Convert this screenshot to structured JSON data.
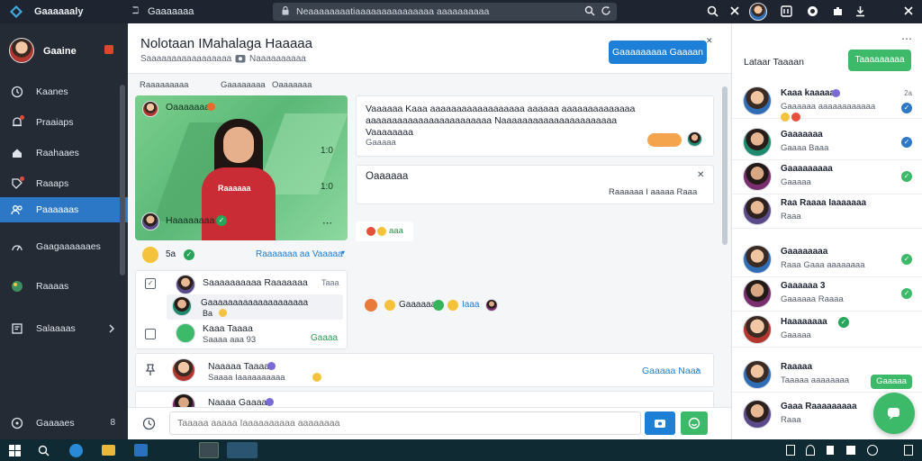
{
  "topbar": {
    "app_name": "Gaaaaaaly",
    "tab_label": "Gaaaaaaa",
    "address": "Neaaaaaaaatiaaaaaaaaaaaaaaa aaaaaaaaaa"
  },
  "sidebar": {
    "user_name": "Gaaine",
    "items": [
      {
        "label": "Kaanes"
      },
      {
        "label": "Praaiaps"
      },
      {
        "label": "Raahaaes"
      },
      {
        "label": "Raaaps"
      },
      {
        "label": "Paaaaaas"
      },
      {
        "label": "Gaagaaaaaaes"
      },
      {
        "label": "Raaaas"
      },
      {
        "label": "Salaaaas"
      }
    ],
    "footer_label": "Gaaaaes",
    "footer_count": "8"
  },
  "header": {
    "title": "Nolotaan IMahalaga Haaaaa",
    "subtitle": "Saaaaaaaaaaaaaaaaa",
    "subtitle_tag": "Naaaaaaaaaa",
    "cta_label": "Gaaaaaaaaa Gaaaan"
  },
  "filters": {
    "item1": "Raaaaaaaaa",
    "item2": "Gaaaaaaaa",
    "item3": "Oaaaaaaa"
  },
  "video": {
    "top_name": "Oaaaaaaa",
    "name": "Haaaaaaaa",
    "shirt_text": "Raaaaaa",
    "counter_top": "1:0",
    "counter_bottom": "1:0"
  },
  "reaction_bar": {
    "count": "5a",
    "link": "Raaaaaaa aa Vaaaaa"
  },
  "message": {
    "text": "Vaaaaaa Kaaa aaaaaaaaaaaaaaaaaa aaaaaa aaaaaaaaaaaaaa aaaaaaaaaaaaaaaaaaaaaaaa Naaaaaaaaaaaaaaaaaaaaaa Vaaaaaaaa",
    "footer": "Gaaaaa"
  },
  "notice": {
    "title": "Oaaaaaa",
    "sub": "Raaaaaa I aaaaa Raaa"
  },
  "reaction_small": "aaa",
  "reaction_mid": "Gaaaaaa",
  "reaction_mid2": "Iaaa",
  "list": {
    "group_title": "Saaaaaaaaaa Raaaaaaa",
    "group_time": "Taaa",
    "group_line": "Gaaaaaaaaaaaaaaaaaaaa",
    "group_small": "Ba",
    "row2_name": "Kaaa Taaaa",
    "row2_sub": "Saaaa aaa 93",
    "row2_action": "Gaaaa",
    "row3_name": "Naaaaa Taaaaa",
    "row3_sub": "Saaaa Iaaaaaaaaaa",
    "row3_link": "Gaaaaa Naaa",
    "row4_name": "Naaaa Gaaaaa"
  },
  "composer": {
    "placeholder": "Taaaaa aaaaa Iaaaaaaaaaa aaaaaaaa"
  },
  "right_panel": {
    "title": "Lataar Taaaan",
    "action": "Taaaaaaaaa",
    "contacts": [
      {
        "name": "Kaaa kaaaaaa",
        "sub": "Gaaaaaa aaaaaaaaaaaa",
        "time": "2a"
      },
      {
        "name": "Gaaaaaaa",
        "sub": "Gaaaa Baaa"
      },
      {
        "name": "Gaaaaaaaaa",
        "sub": "Gaaaaa"
      },
      {
        "name": "Raa Raaaa Iaaaaaaa",
        "sub": "Raaa"
      },
      {
        "name": "Gaaaaaaaa",
        "sub": "Raaa Gaaa aaaaaaaa"
      },
      {
        "name": "Gaaaaaa 3",
        "sub": "Gaaaaaa Raaaa"
      },
      {
        "name": "Haaaaaaaa",
        "sub": "Gaaaaa"
      },
      {
        "name": "Raaaaa",
        "sub": "Taaaaa aaaaaaaa",
        "action": "Gaaaaa"
      },
      {
        "name": "Gaaa Raaaaaaaaa",
        "sub": "Raaa"
      }
    ]
  },
  "colors": {
    "accent": "#1e7fd6",
    "green": "#3cba6a",
    "sidebar": "#252b35",
    "topbar": "#1e2530"
  }
}
